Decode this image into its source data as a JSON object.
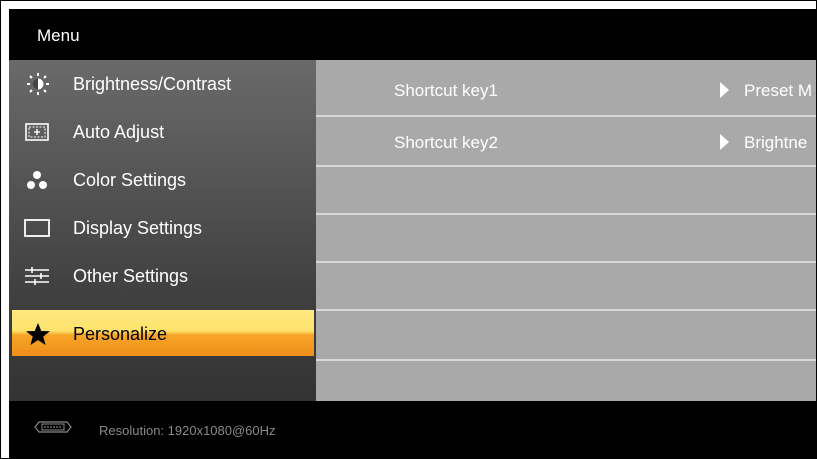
{
  "header": {
    "title": "Menu"
  },
  "sidebar": {
    "items": [
      {
        "label": "Brightness/Contrast",
        "icon": "brightness-icon"
      },
      {
        "label": "Auto Adjust",
        "icon": "auto-adjust-icon"
      },
      {
        "label": "Color Settings",
        "icon": "color-dots-icon"
      },
      {
        "label": "Display Settings",
        "icon": "display-rect-icon"
      },
      {
        "label": "Other Settings",
        "icon": "sliders-icon"
      },
      {
        "label": "Personalize",
        "icon": "star-icon",
        "selected": true
      }
    ]
  },
  "content": {
    "rows": [
      {
        "label": "Shortcut key1",
        "value": "Preset M"
      },
      {
        "label": "Shortcut key2",
        "value": "Brightne"
      }
    ]
  },
  "footer": {
    "connector_icon": "vga-connector-icon",
    "resolution": "Resolution:  1920x1080@60Hz"
  },
  "colors": {
    "selected_top": "#ffe880",
    "selected_bottom": "#f18f1a",
    "content_bg": "#a9a9a9",
    "header_bg": "#000000"
  }
}
